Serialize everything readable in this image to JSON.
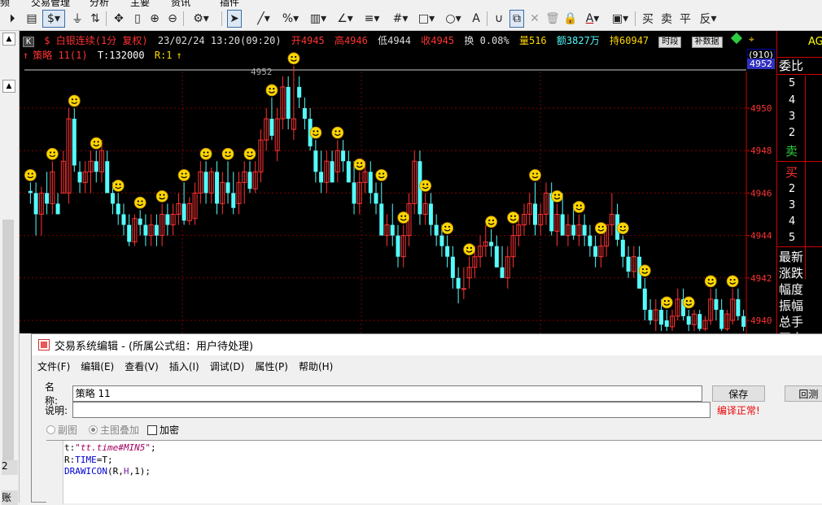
{
  "topmenu": {
    "items": [
      "频",
      "交易管理",
      "分析",
      "主要",
      "资讯",
      "插件"
    ]
  },
  "toolbar": {
    "icons": [
      "play-circle-icon",
      "notes-icon",
      "dollar-icon",
      "funnel-icon",
      "switch-icon",
      "move-icon",
      "column-icon",
      "zoom-in-icon",
      "zoom-out-icon",
      "gear-icon",
      "cursor-icon",
      "line-icon",
      "percent-icon",
      "ruler-icon",
      "angle-icon",
      "hlines-icon",
      "grid-icon",
      "rect-icon",
      "circle-icon",
      "text-icon",
      "magnet-icon",
      "copy-icon",
      "close-icon",
      "trash-icon",
      "lock-icon",
      "color-icon",
      "save-icon",
      "buy-icon",
      "sell-icon",
      "flat-icon",
      "reverse-icon"
    ],
    "labels": {
      "dollar": "$",
      "text": "A",
      "buy": "买",
      "sell": "卖",
      "flat": "平",
      "reverse": "反"
    }
  },
  "left": {
    "item1": "账",
    "item2": "2"
  },
  "chart": {
    "k_badge": "K",
    "symbol": "$ 白银连续(1分 复权)",
    "datetime": "23/02/24 13:20(09:20)",
    "open": "开4945",
    "high": "高4946",
    "low": "低4944",
    "close": "收4945",
    "change_rate": "换 0.08%",
    "volume": "量516",
    "amount": "额3827万",
    "hold": "持60947",
    "btn_period": "时段",
    "btn_supplement": "补数据",
    "strategy_line": "策略 11(1)",
    "t_value": "T:132000",
    "r_value": "R:1",
    "high_marker": "4952",
    "badge_top": "(910)",
    "badge_price": "4952",
    "axis_labels": [
      "4950",
      "4948",
      "4946",
      "4944",
      "4942",
      "4940"
    ],
    "colors": {
      "up": "#ff3232",
      "down": "#54fcfc",
      "grid": "#800000",
      "icon": "#ffd700"
    }
  },
  "chart_data": {
    "type": "candlestick",
    "ylim": [
      4939.5,
      4952.2
    ],
    "candles": [
      [
        4946.1,
        4946.5,
        4945.5,
        4946.0
      ],
      [
        4946.0,
        4946.5,
        4944.0,
        4945.0
      ],
      [
        4945.0,
        4946.3,
        4944.0,
        4946.0
      ],
      [
        4946.0,
        4947.0,
        4945.0,
        4945.5
      ],
      [
        4945.5,
        4947.5,
        4945.0,
        4947.0
      ],
      [
        4945.5,
        4946.0,
        4945.0,
        4945.0
      ],
      [
        4946.0,
        4948.0,
        4946.0,
        4947.5
      ],
      [
        4946.0,
        4950.0,
        4945.5,
        4949.5
      ],
      [
        4949.5,
        4950.0,
        4947.0,
        4947.3
      ],
      [
        4947.0,
        4947.5,
        4946.0,
        4946.5
      ],
      [
        4946.5,
        4947.5,
        4946.0,
        4947.0
      ],
      [
        4947.0,
        4948.0,
        4946.0,
        4947.5
      ],
      [
        4947.5,
        4948.0,
        4946.5,
        4947.0
      ],
      [
        4947.0,
        4948.5,
        4946.5,
        4948.0
      ],
      [
        4947.5,
        4948.0,
        4946.0,
        4946.0
      ],
      [
        4946.0,
        4946.5,
        4945.0,
        4945.5
      ],
      [
        4945.5,
        4946.0,
        4944.5,
        4945.0
      ],
      [
        4945.0,
        4945.5,
        4944.0,
        4944.5
      ],
      [
        4944.5,
        4945.0,
        4943.5,
        4943.7
      ],
      [
        4943.7,
        4945.0,
        4943.5,
        4944.8
      ],
      [
        4944.8,
        4945.2,
        4944.0,
        4944.5
      ],
      [
        4944.5,
        4945.0,
        4943.5,
        4944.0
      ],
      [
        4944.0,
        4945.0,
        4943.5,
        4944.5
      ],
      [
        4944.5,
        4945.0,
        4943.5,
        4944.0
      ],
      [
        4944.0,
        4945.5,
        4943.5,
        4945.0
      ],
      [
        4945.0,
        4945.5,
        4944.0,
        4944.5
      ],
      [
        4944.5,
        4945.5,
        4944.0,
        4945.0
      ],
      [
        4945.0,
        4946.0,
        4944.5,
        4945.5
      ],
      [
        4945.5,
        4946.5,
        4944.5,
        4944.7
      ],
      [
        4944.7,
        4945.8,
        4944.5,
        4945.5
      ],
      [
        4944.8,
        4946.5,
        4944.5,
        4946.0
      ],
      [
        4946.0,
        4947.5,
        4945.5,
        4947.0
      ],
      [
        4947.0,
        4947.5,
        4945.5,
        4946.0
      ],
      [
        4946.0,
        4947.2,
        4945.5,
        4947.0
      ],
      [
        4947.0,
        4947.5,
        4945.0,
        4945.5
      ],
      [
        4945.5,
        4947.0,
        4945.0,
        4946.5
      ],
      [
        4946.5,
        4947.5,
        4945.5,
        4946.0
      ],
      [
        4946.0,
        4947.0,
        4945.0,
        4945.3
      ],
      [
        4945.5,
        4947.0,
        4945.0,
        4946.5
      ],
      [
        4946.5,
        4947.5,
        4945.5,
        4947.0
      ],
      [
        4947.0,
        4947.5,
        4946.0,
        4946.2
      ],
      [
        4946.2,
        4947.5,
        4946.0,
        4947.0
      ],
      [
        4947.0,
        4949.0,
        4946.5,
        4948.5
      ],
      [
        4948.5,
        4950.0,
        4948.0,
        4949.5
      ],
      [
        4949.5,
        4950.5,
        4948.5,
        4948.7
      ],
      [
        4948.0,
        4950.0,
        4947.5,
        4949.5
      ],
      [
        4949.5,
        4951.5,
        4949.0,
        4951.0
      ],
      [
        4951.0,
        4951.5,
        4949.0,
        4949.5
      ],
      [
        4949.0,
        4952.0,
        4948.5,
        4949.5
      ],
      [
        4951.0,
        4951.5,
        4950.0,
        4950.5
      ],
      [
        4950.0,
        4950.5,
        4949.0,
        4949.5
      ],
      [
        4949.5,
        4950.0,
        4948.0,
        4948.2
      ],
      [
        4948.0,
        4948.5,
        4946.5,
        4947.0
      ],
      [
        4947.0,
        4948.0,
        4946.0,
        4946.5
      ],
      [
        4946.5,
        4948.0,
        4946.0,
        4947.5
      ],
      [
        4947.5,
        4948.0,
        4946.5,
        4946.5
      ],
      [
        4947.0,
        4948.5,
        4946.5,
        4948.0
      ],
      [
        4948.0,
        4948.5,
        4947.0,
        4947.5
      ],
      [
        4947.5,
        4948.0,
        4946.5,
        4946.5
      ],
      [
        4946.5,
        4947.5,
        4945.0,
        4945.5
      ],
      [
        4945.5,
        4947.0,
        4945.0,
        4946.5
      ],
      [
        4946.5,
        4947.5,
        4946.0,
        4947.0
      ],
      [
        4947.0,
        4947.5,
        4945.5,
        4946.0
      ],
      [
        4946.0,
        4946.5,
        4945.0,
        4945.5
      ],
      [
        4945.5,
        4946.5,
        4944.5,
        4944.0
      ],
      [
        4944.0,
        4945.0,
        4943.5,
        4944.5
      ],
      [
        4944.5,
        4945.5,
        4943.5,
        4944.0
      ],
      [
        4944.0,
        4944.5,
        4942.5,
        4943.0
      ],
      [
        4943.0,
        4944.5,
        4942.5,
        4944.0
      ],
      [
        4944.0,
        4946.0,
        4943.5,
        4945.5
      ],
      [
        4945.5,
        4948.0,
        4945.0,
        4947.5
      ],
      [
        4947.5,
        4948.0,
        4944.5,
        4945.0
      ],
      [
        4945.0,
        4946.0,
        4944.5,
        4945.5
      ],
      [
        4945.5,
        4946.0,
        4944.0,
        4944.5
      ],
      [
        4944.5,
        4945.0,
        4943.5,
        4944.0
      ],
      [
        4944.0,
        4944.5,
        4943.0,
        4943.5
      ],
      [
        4943.5,
        4944.0,
        4942.5,
        4943.0
      ],
      [
        4943.0,
        4943.5,
        4941.5,
        4942.0
      ],
      [
        4942.0,
        4942.5,
        4940.8,
        4941.5
      ],
      [
        4941.5,
        4942.5,
        4941.0,
        4941.5
      ],
      [
        4942.0,
        4943.0,
        4941.5,
        4942.5
      ],
      [
        4942.5,
        4943.5,
        4942.0,
        4943.0
      ],
      [
        4943.0,
        4944.0,
        4942.5,
        4943.5
      ],
      [
        4943.5,
        4944.5,
        4943.0,
        4943.7
      ],
      [
        4943.7,
        4944.3,
        4943.0,
        4943.5
      ],
      [
        4943.5,
        4944.0,
        4942.5,
        4942.5
      ],
      [
        4942.5,
        4943.5,
        4942.0,
        4942.0
      ],
      [
        4942.0,
        4943.5,
        4941.5,
        4943.0
      ],
      [
        4943.0,
        4944.5,
        4942.5,
        4944.0
      ],
      [
        4944.0,
        4945.0,
        4943.5,
        4944.5
      ],
      [
        4944.5,
        4945.5,
        4944.0,
        4945.0
      ],
      [
        4945.0,
        4946.0,
        4944.5,
        4945.5
      ],
      [
        4945.5,
        4946.5,
        4944.0,
        4944.5
      ],
      [
        4944.5,
        4945.5,
        4944.0,
        4945.0
      ],
      [
        4945.0,
        4946.5,
        4944.5,
        4946.0
      ],
      [
        4946.0,
        4946.5,
        4944.0,
        4944.2
      ],
      [
        4944.2,
        4945.5,
        4943.5,
        4945.0
      ],
      [
        4945.0,
        4946.0,
        4944.0,
        4944.0
      ],
      [
        4944.0,
        4945.0,
        4943.5,
        4944.5
      ],
      [
        4944.5,
        4945.5,
        4943.8,
        4944.0
      ],
      [
        4944.0,
        4945.0,
        4943.5,
        4944.5
      ],
      [
        4944.5,
        4945.0,
        4943.5,
        4944.0
      ],
      [
        4944.0,
        4944.5,
        4943.0,
        4943.5
      ],
      [
        4943.5,
        4944.0,
        4942.5,
        4943.0
      ],
      [
        4943.0,
        4944.0,
        4942.5,
        4943.5
      ],
      [
        4943.5,
        4944.5,
        4943.0,
        4944.5
      ],
      [
        4944.5,
        4946.0,
        4944.0,
        4945.0
      ],
      [
        4945.0,
        4945.5,
        4943.5,
        4943.8
      ],
      [
        4943.8,
        4944.0,
        4942.5,
        4943.0
      ],
      [
        4943.0,
        4943.5,
        4942.0,
        4942.3
      ],
      [
        4942.3,
        4943.5,
        4942.0,
        4943.0
      ],
      [
        4943.0,
        4943.5,
        4941.5,
        4941.5
      ],
      [
        4941.5,
        4942.0,
        4940.0,
        4940.5
      ],
      [
        4940.5,
        4941.0,
        4939.8,
        4940.0
      ],
      [
        4940.0,
        4941.0,
        4939.5,
        4940.5
      ],
      [
        4940.5,
        4941.0,
        4939.5,
        4939.8
      ],
      [
        4940.0,
        4940.5,
        4939.5,
        4939.7
      ],
      [
        4939.7,
        4940.5,
        4939.5,
        4940.2
      ],
      [
        4940.2,
        4941.5,
        4940.0,
        4941.0
      ],
      [
        4941.0,
        4941.5,
        4940.0,
        4940.2
      ],
      [
        4940.2,
        4940.5,
        4939.5,
        4939.8
      ],
      [
        4939.8,
        4940.5,
        4939.5,
        4940.3
      ],
      [
        4940.3,
        4940.5,
        4939.5,
        4939.6
      ],
      [
        4939.6,
        4940.2,
        4939.5,
        4940.0
      ],
      [
        4940.0,
        4941.5,
        4939.8,
        4941.0
      ],
      [
        4941.0,
        4941.5,
        4940.0,
        4940.5
      ],
      [
        4940.5,
        4941.0,
        4939.5,
        4939.6
      ],
      [
        4939.6,
        4940.5,
        4939.5,
        4940.3
      ],
      [
        4940.0,
        4941.5,
        4939.8,
        4941.0
      ],
      [
        4941.0,
        4941.5,
        4940.0,
        4940.2
      ],
      [
        4940.2,
        4940.5,
        4939.5,
        4939.7
      ]
    ],
    "signals": [
      0,
      4,
      8,
      12,
      16,
      20,
      24,
      28,
      32,
      36,
      40,
      44,
      48,
      52,
      56,
      60,
      64,
      68,
      72,
      76,
      80,
      84,
      88,
      92,
      96,
      100,
      104,
      108,
      112,
      116,
      120,
      124,
      128
    ]
  },
  "right_panel": {
    "top": "AG",
    "ratio_label": "委比",
    "ask_levels": [
      "5",
      "4",
      "3",
      "2"
    ],
    "ask_label": "卖",
    "bid_label": "买",
    "bid_levels": [
      "2",
      "3",
      "4",
      "5"
    ],
    "labels_below": [
      "最新",
      "涨跌",
      "幅度",
      "振幅",
      "总手",
      "开仓"
    ]
  },
  "dialog": {
    "title": "交易系统编辑 - (所属公式组：用户待处理)",
    "menu": [
      "文件(F)",
      "编辑(E)",
      "查看(V)",
      "插入(I)",
      "调试(D)",
      "属性(P)",
      "帮助(H)"
    ],
    "name_label": "名称:",
    "name_value": "策略 11",
    "desc_label": "说明:",
    "desc_value": "",
    "save_button": "保存",
    "test_button": "回测",
    "compile_status": "编译正常!",
    "radio_sub": "副图",
    "radio_main": "主图叠加",
    "encrypt": "加密",
    "code": {
      "l1_var": "t",
      "l1_op": ":",
      "l1_str": "\"tt.time#MIN5\"",
      "l1_end": ";",
      "l2_var": "R",
      "l2_op": ":",
      "l2_kw": "TIME",
      "l2_rest": "=T",
      "l2_end": ";",
      "l3_fn": "DRAWICON",
      "l3_open": "(R,",
      "l3_h": "H",
      "l3_rest": ",1);"
    }
  }
}
